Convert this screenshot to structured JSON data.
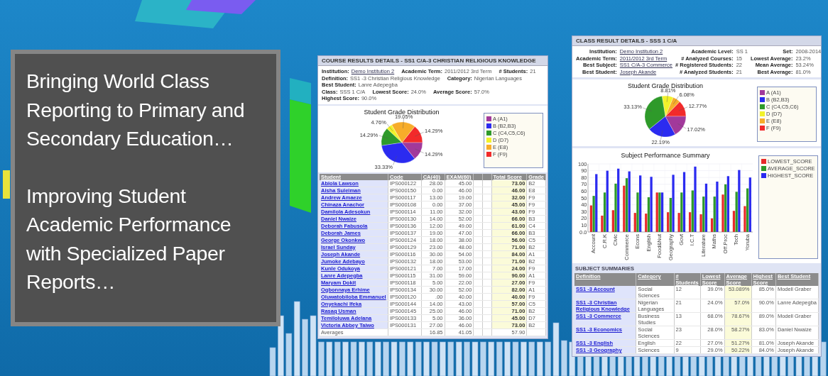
{
  "banner": {
    "paragraphs": [
      "Bringing World Class Reporting to Primary and Secondary Education…",
      "Improving Student Academic Performance with Specialized Paper Reports…"
    ]
  },
  "course_report": {
    "title": "COURSE RESULTS DETAILS - SS1 C/A-3 CHRISTIAN RELIGIOUS KNOWLEDGE",
    "details": [
      [
        {
          "label": "Institution:",
          "value": "Demo Institution 2",
          "link": true
        },
        {
          "label": "Academic Term:",
          "value": "2011/2012 3rd Term",
          "link": false
        },
        {
          "label": "# Students:",
          "value": "21",
          "link": false
        }
      ],
      [
        {
          "label": "Definition:",
          "value": "SS1 -3 Christian Religious Knowledge",
          "link": false
        },
        {
          "label": "Category:",
          "value": "Nigerian Languages",
          "link": false
        },
        {
          "label": "Best Student:",
          "value": "Lanre Adepegba",
          "link": false
        }
      ],
      [
        {
          "label": "Class:",
          "value": "SSS 1 C/A",
          "link": false
        },
        {
          "label": "Lowest Score:",
          "value": "24.0%",
          "link": false
        },
        {
          "label": "Average Score:",
          "value": "57.0%",
          "link": false
        },
        {
          "label": "Highest Score:",
          "value": "90.0%",
          "link": false
        }
      ]
    ],
    "grade_distribution": {
      "chart_data": {
        "type": "pie",
        "title": "Student Grade Distribution",
        "categories": [
          "A (A1)",
          "B (B2,B3)",
          "C (C4,C5,C6)",
          "D (D7)",
          "E (E8)",
          "F (F9)"
        ],
        "values": [
          14.29,
          33.33,
          14.29,
          4.76,
          19.05,
          14.29
        ],
        "colors": [
          "#a2399b",
          "#2b2bf0",
          "#2e9a2a",
          "#f2f22a",
          "#f7ad2a",
          "#f22a2a"
        ],
        "value_labels": [
          "14.29%",
          "33.33%",
          "14.29%",
          "4.76%",
          "19.05%",
          "14.29%"
        ]
      }
    },
    "table": {
      "columns": [
        "Student",
        "Code",
        "CA(40)",
        "EXAM(60)",
        "Total Score",
        "Grade"
      ],
      "rows": [
        [
          "Abiola Lawson",
          "IPS000122",
          "28.00",
          "45.00",
          "73.00",
          "B2"
        ],
        [
          "Aisha Suleiman",
          "IPS000150",
          "0.00",
          "46.00",
          "46.00",
          "E8"
        ],
        [
          "Andrew Amaeze",
          "IPS000117",
          "13.00",
          "19.00",
          "32.00",
          "F9"
        ],
        [
          "Chinaza Anachor",
          "IPS000108",
          "0.00",
          "37.00",
          "45.00",
          "F9"
        ],
        [
          "Damilola Adesokun",
          "IPS000114",
          "11.00",
          "32.00",
          "43.00",
          "F9"
        ],
        [
          "Daniel Nwaize",
          "IPS000130",
          "14.00",
          "52.00",
          "66.00",
          "B3"
        ],
        [
          "Deborah Fabusola",
          "IPS000136",
          "12.00",
          "49.00",
          "61.00",
          "C4"
        ],
        [
          "Deborah James",
          "IPS000137",
          "19.00",
          "47.00",
          "66.00",
          "B3"
        ],
        [
          "George Okonkwo",
          "IPS000124",
          "18.00",
          "38.00",
          "56.00",
          "C5"
        ],
        [
          "Israel Sunday",
          "IPS000129",
          "23.00",
          "48.00",
          "71.00",
          "B2"
        ],
        [
          "Joseph Akande",
          "IPS000116",
          "30.00",
          "54.00",
          "84.00",
          "A1"
        ],
        [
          "Jumoke Adebayo",
          "IPS000132",
          "18.00",
          "53.00",
          "71.00",
          "B2"
        ],
        [
          "Kunle Odukoya",
          "IPS000121",
          "7.00",
          "17.00",
          "24.00",
          "F9"
        ],
        [
          "Lanre Adepegba",
          "IPS000115",
          "31.00",
          "59.00",
          "90.00",
          "A1"
        ],
        [
          "Maryam Dokit",
          "IPS000118",
          "5.00",
          "22.00",
          "27.00",
          "F9"
        ],
        [
          "Ogbonnaya Erhime",
          "IPS000134",
          "30.00",
          "52.00",
          "82.00",
          "A1"
        ],
        [
          "Oluwatobiloba Emmanuel",
          "IPS000120",
          ".00",
          "40.00",
          "40.00",
          "F9"
        ],
        [
          "Onyekachi Ifeka",
          "IPS000144",
          "14.00",
          "43.00",
          "57.00",
          "C5"
        ],
        [
          "Rasaq Usman",
          "IPS000145",
          "25.00",
          "46.00",
          "71.00",
          "B2"
        ],
        [
          "Temiloluwa Adelana",
          "IPS000133",
          "5.00",
          "36.00",
          "45.00",
          "D7"
        ],
        [
          "Victoria Abbey Taiwo",
          "IPS000131",
          "27.00",
          "46.00",
          "73.00",
          "B2"
        ]
      ],
      "averages": {
        "label": "Averages",
        "ca": "16.85",
        "exam": "41.05",
        "total": "57.90"
      }
    }
  },
  "class_report": {
    "title": "CLASS RESULT DETAILS - SSS 1 C/A",
    "details": [
      [
        {
          "label": "Institution:",
          "value": "Demo Institution 2",
          "link": true
        },
        {
          "label": "Academic Level:",
          "value": "SS 1",
          "link": false
        },
        {
          "label": "Set:",
          "value": "2008-2014",
          "link": false
        }
      ],
      [
        {
          "label": "Academic Term:",
          "value": "2011/2012 3rd Term",
          "link": true
        },
        {
          "label": "# Analyzed Courses:",
          "value": "15",
          "link": false
        },
        {
          "label": "Lowest Average:",
          "value": "23.2%",
          "link": false
        }
      ],
      [
        {
          "label": "Best Subject:",
          "value": "SS1 C/A-3 Commerce",
          "link": true
        },
        {
          "label": "# Registered Students:",
          "value": "22",
          "link": false
        },
        {
          "label": "Mean Average:",
          "value": "53.24%",
          "link": false
        }
      ],
      [
        {
          "label": "Best Student:",
          "value": "Joseph Akande",
          "link": true
        },
        {
          "label": "# Analyzed Students:",
          "value": "21",
          "link": false
        },
        {
          "label": "Best Average:",
          "value": "81.0%",
          "link": false
        }
      ]
    ],
    "grade_distribution": {
      "chart_data": {
        "type": "pie",
        "title": "Student Grade Distribution",
        "categories": [
          "A (A1)",
          "B (B2,B3)",
          "C (C4,C5,C6)",
          "D (D7)",
          "E (E8)",
          "F (F9)"
        ],
        "values": [
          17.02,
          22.19,
          33.13,
          8.81,
          6.08,
          12.77
        ],
        "colors": [
          "#a2399b",
          "#2b2bf0",
          "#2e9a2a",
          "#f2f22a",
          "#f7ad2a",
          "#f22a2a"
        ],
        "value_labels": [
          "17.02%",
          "22.19%",
          "33.13%",
          "8.81%",
          "6.08%",
          "12.77%"
        ]
      }
    },
    "performance_summary": {
      "chart_data": {
        "type": "bar",
        "title": "Subject Performance Summary",
        "categories": [
          "Account",
          "C.R.K",
          "Civic",
          "Commerce",
          "Econs",
          "English",
          "Food&Nut",
          "Geography",
          "Govt",
          "I.C.T",
          "Literature",
          "Maths",
          "Off.Proc",
          "Tech",
          "Yoruba"
        ],
        "series": [
          {
            "name": "LOWEST_SCORE",
            "color": "#e82a2a",
            "values": [
              39,
              24,
              32,
              68,
              28,
              27,
              58,
              29,
              28,
              29,
              26,
              20,
              55,
              31,
              38
            ]
          },
          {
            "name": "AVERAGE_SCORE",
            "color": "#2e9a2a",
            "values": [
              53,
              58,
              71,
              79,
              58,
              51,
              58,
              50,
              58,
              61,
              52,
              52,
              70,
              59,
              64
            ]
          },
          {
            "name": "HIGHEST_SCORE",
            "color": "#2b2bf0",
            "values": [
              85,
              90,
              93,
              89,
              83,
              81,
              58,
              84,
              88,
              96,
              71,
              74,
              82,
              91,
              80
            ]
          }
        ],
        "grid": true,
        "ylim": [
          0,
          100
        ],
        "yticks": [
          {
            "value": 0,
            "label": "0.0"
          },
          10,
          20,
          30,
          40,
          50,
          60,
          70,
          80,
          90,
          100
        ]
      }
    },
    "summaries": {
      "title": "SUBJECT SUMMARIES",
      "columns": [
        "Definition",
        "Category",
        "# Students",
        "Lowest Score",
        "Average Score",
        "Highest Score",
        "Best Student"
      ],
      "rows": [
        [
          "SS1 -3 Account",
          "Social Sciences",
          "12",
          "39.0%",
          "53.089%",
          "85.0%",
          "Modell Graber"
        ],
        [
          "SS1 -3 Christian Religious Knowledge",
          "Nigerian Languages",
          "21",
          "24.0%",
          "57.0%",
          "90.0%",
          "Lanre Adepegba"
        ],
        [
          "SS1 -3 Commerce",
          "Business Studies",
          "13",
          "68.0%",
          "78.67%",
          "89.0%",
          "Modell Graber"
        ],
        [
          "SS1 -3 Economics",
          "Social Sciences",
          "23",
          "28.0%",
          "58.27%",
          "83.0%",
          "Daniel Nwaize"
        ],
        [
          "SS1 -3 English",
          "English",
          "22",
          "27.0%",
          "51.27%",
          "81.0%",
          "Joseph Akande"
        ],
        [
          "SS1 -3 Geography",
          "Sciences",
          "9",
          "29.0%",
          "50.22%",
          "84.0%",
          "Joseph Akande"
        ]
      ]
    }
  }
}
